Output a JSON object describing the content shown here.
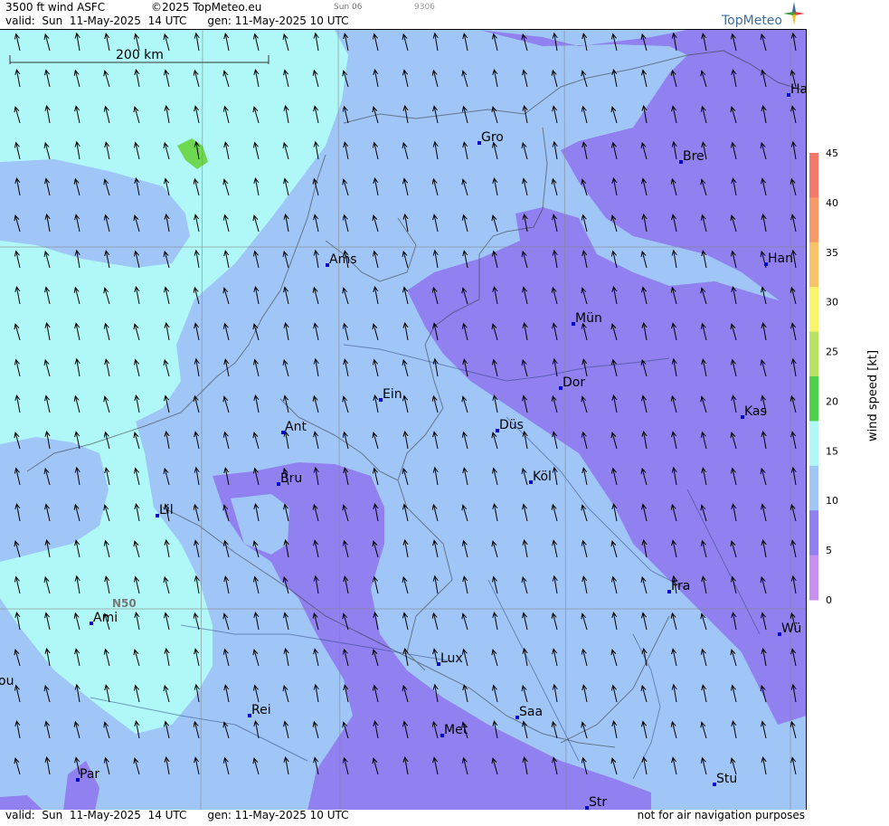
{
  "header": {
    "product": "3500 ft wind ASFC",
    "copyright": "©2025 TopMeteo.eu",
    "run": "Sun 06",
    "code": "9306",
    "valid_line": "valid:  Sun  11-May-2025  14 UTC      gen: 11-May-2025 10 UTC",
    "brand": "TopMeteo"
  },
  "map": {
    "scale_label": "200 km",
    "lat_label": "N50",
    "cities": [
      {
        "name": "Ha"
      },
      {
        "name": "Gro"
      },
      {
        "name": "Bre"
      },
      {
        "name": "Ams"
      },
      {
        "name": "Han"
      },
      {
        "name": "Mün"
      },
      {
        "name": "Ein"
      },
      {
        "name": "Dor"
      },
      {
        "name": "Ant"
      },
      {
        "name": "Düs"
      },
      {
        "name": "Kas"
      },
      {
        "name": "Bru"
      },
      {
        "name": "Köl"
      },
      {
        "name": "Lil"
      },
      {
        "name": "Fra"
      },
      {
        "name": "Ami"
      },
      {
        "name": "Wü"
      },
      {
        "name": "ou"
      },
      {
        "name": "Lux"
      },
      {
        "name": "Rei"
      },
      {
        "name": "Saa"
      },
      {
        "name": "Met"
      },
      {
        "name": "Par"
      },
      {
        "name": "Stu"
      },
      {
        "name": "Str"
      }
    ],
    "wind_direction": "from south-east (arrows pointing north-west)"
  },
  "legend": {
    "title": "wind speed  [kt]",
    "ticks": [
      "45",
      "40",
      "35",
      "30",
      "25",
      "20",
      "15",
      "10",
      "5",
      "0"
    ],
    "colors": [
      "#f4786a",
      "#f59a68",
      "#f7c268",
      "#faf46c",
      "#b7e264",
      "#4fd04a",
      "#b0f8f8",
      "#a0c6f8",
      "#9080f0",
      "#c890f0"
    ]
  },
  "footer": {
    "valid_line": "valid:  Sun  11-May-2025  14 UTC      gen: 11-May-2025 10 UTC",
    "note": "not for air navigation purposes"
  }
}
